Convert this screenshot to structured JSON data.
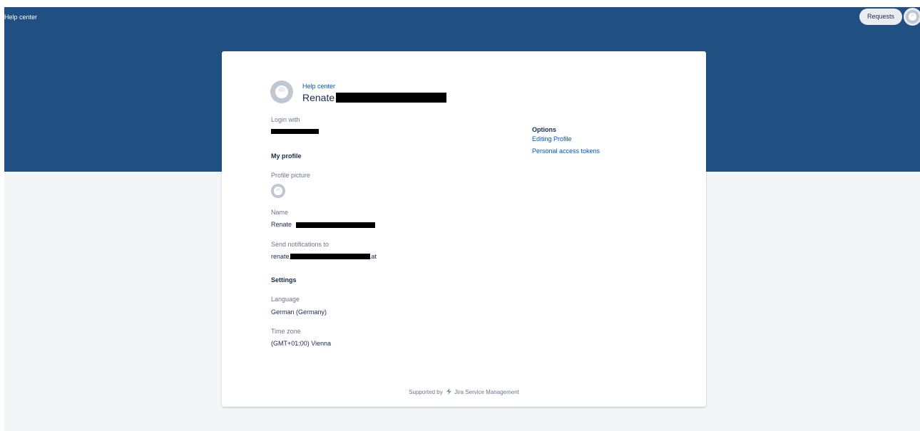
{
  "header": {
    "brand": "Help center",
    "requests_label": "Requests"
  },
  "profile_header": {
    "breadcrumb": "Help center",
    "display_name": "Renate"
  },
  "login": {
    "label": "Login with"
  },
  "my_profile": {
    "heading": "My profile",
    "picture_label": "Profile picture",
    "name_label": "Name",
    "name_value": "Renate",
    "notify_label": "Send notifications to",
    "notify_prefix": "renate.",
    "notify_suffix": ".at"
  },
  "settings": {
    "heading": "Settings",
    "language_label": "Language",
    "language_value": "German (Germany)",
    "timezone_label": "Time zone",
    "timezone_value": "(GMT+01:00) Vienna"
  },
  "options": {
    "heading": "Options",
    "items": [
      {
        "label": "Editing Profile"
      },
      {
        "label": "Personal access tokens"
      }
    ]
  },
  "footer": {
    "prefix": "Supported by",
    "product": "Jira Service Management"
  },
  "colors": {
    "header_bg": "#205081",
    "page_bg": "#f4f5f7",
    "link": "#0052cc",
    "text": "#172b4d",
    "muted": "#6b778c"
  }
}
